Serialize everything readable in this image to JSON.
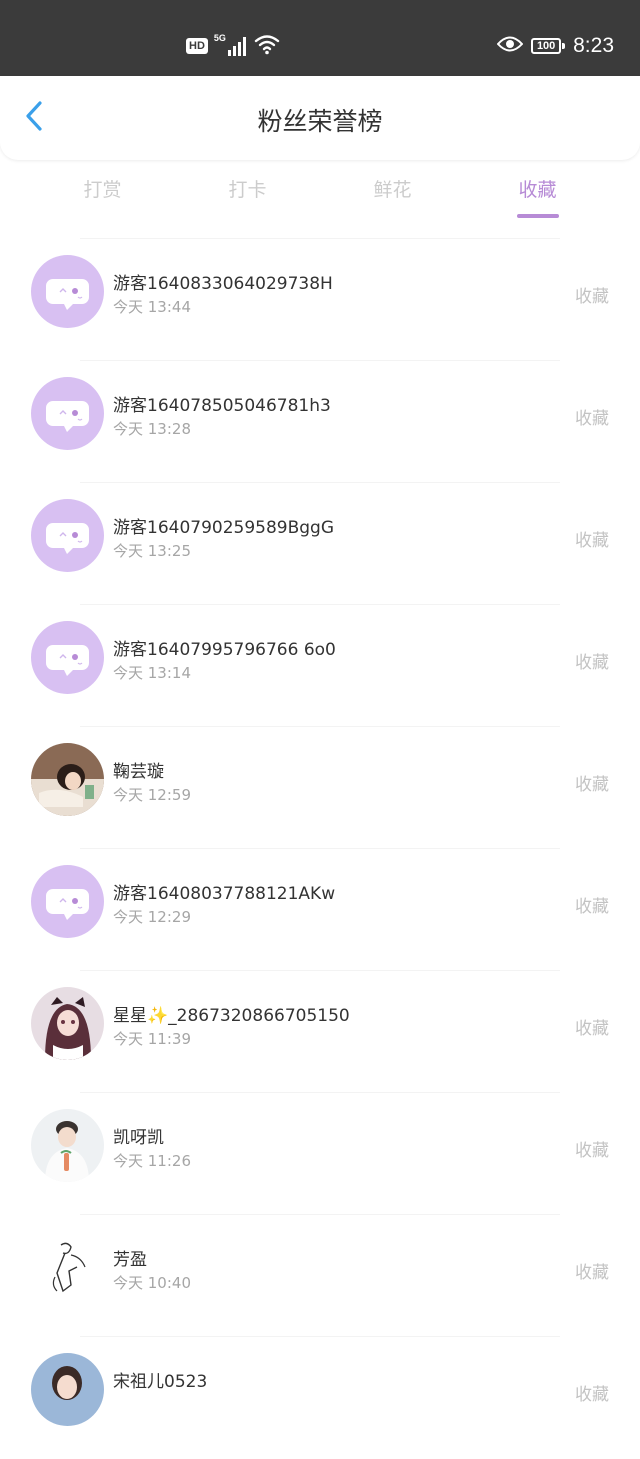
{
  "status_bar": {
    "hd_label": "HD",
    "network_label": "5G",
    "battery_level": "100",
    "time": "8:23",
    "icons": [
      "signal-icon",
      "wifi-icon",
      "eye-icon",
      "battery-icon"
    ]
  },
  "header": {
    "title": "粉丝荣誉榜",
    "back_icon": "chevron-left-icon"
  },
  "tabs": [
    {
      "label": "打赏",
      "active": false
    },
    {
      "label": "打卡",
      "active": false
    },
    {
      "label": "鲜花",
      "active": false
    },
    {
      "label": "收藏",
      "active": true
    }
  ],
  "colors": {
    "accent": "#b78bd6",
    "default_avatar_bg": "#d8c0f2",
    "back_arrow": "#3aa0ea",
    "status_bar_bg": "#3b3b3b"
  },
  "rows": [
    {
      "name": "游客1640833064029738H",
      "time": "今天 13:44",
      "action": "收藏",
      "avatar": "default-avatar-icon"
    },
    {
      "name": "游客164078505046781h3",
      "time": "今天 13:28",
      "action": "收藏",
      "avatar": "default-avatar-icon"
    },
    {
      "name": "游客1640790259589BggG",
      "time": "今天 13:25",
      "action": "收藏",
      "avatar": "default-avatar-icon"
    },
    {
      "name": "游客16407995796766 6o0",
      "time": "今天 13:14",
      "action": "收藏",
      "avatar": "default-avatar-icon"
    },
    {
      "name": "鞠芸璇",
      "time": "今天 12:59",
      "action": "收藏",
      "avatar": "user-photo-avatar"
    },
    {
      "name": "游客16408037788121AKw",
      "time": "今天 12:29",
      "action": "收藏",
      "avatar": "default-avatar-icon"
    },
    {
      "name": "星星✨_2867320866705150",
      "time": "今天 11:39",
      "action": "收藏",
      "avatar": "user-photo-avatar"
    },
    {
      "name": "凯呀凯",
      "time": "今天 11:26",
      "action": "收藏",
      "avatar": "user-photo-avatar"
    },
    {
      "name": "芳盈",
      "time": "今天 10:40",
      "action": "收藏",
      "avatar": "sketch-avatar"
    },
    {
      "name": "宋祖儿0523",
      "time": "",
      "action": "收藏",
      "avatar": "user-photo-avatar"
    }
  ]
}
